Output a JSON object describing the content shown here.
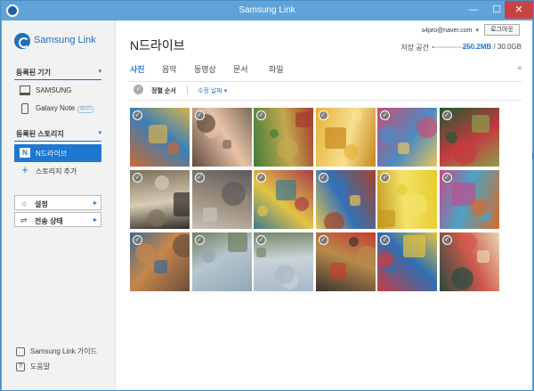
{
  "window": {
    "title": "Samsung Link",
    "min_glyph": "—",
    "max_glyph": "☐",
    "close_glyph": "✕"
  },
  "sidebar": {
    "logo_text": "Samsung Link",
    "devices_header": "등록된 기기",
    "devices": [
      {
        "label": "SAMSUNG",
        "icon": "laptop-icon"
      },
      {
        "label": "Galaxy Note",
        "icon": "phone-icon",
        "badge": "Wi-Fi"
      }
    ],
    "storages_header": "등록된 스토리지",
    "storages": [
      {
        "label": "N드라이브",
        "icon": "ndrive-icon",
        "badge_letter": "N",
        "active": true
      },
      {
        "label": "스토리지 추가",
        "icon": "plus-icon",
        "glyph": "+"
      }
    ],
    "settings_btn": {
      "label": "설정",
      "glyph": "☼",
      "arrow": "▸"
    },
    "transfer_btn": {
      "label": "전송 상태",
      "glyph": "⇌",
      "arrow": "▸"
    },
    "guide_label": "Samsung Link 가이드",
    "help_label": "도움말",
    "help_glyph": "?",
    "chevron": "▾"
  },
  "header": {
    "account": "s4pro@naver.com",
    "account_dropdown": "▾",
    "logout_label": "로그아웃",
    "page_title": "N드라이브",
    "storage_label": "저장 공간",
    "storage_used": "250.2MB",
    "storage_total": "/ 30.0GB",
    "storage_fraction": 0.01
  },
  "tabs": [
    {
      "label": "사진",
      "active": true
    },
    {
      "label": "음악",
      "active": false
    },
    {
      "label": "동영상",
      "active": false
    },
    {
      "label": "문서",
      "active": false
    },
    {
      "label": "파일",
      "active": false
    }
  ],
  "view_toggle": {
    "list_glyph": "≡",
    "grid_glyph": "▦"
  },
  "toolbar": {
    "sort_label": "정렬 순서",
    "sort_value": "수정 날짜",
    "sort_arrow": "▾",
    "check_glyph": "✓"
  },
  "photos": [
    {
      "name": "photo-storefront",
      "colors": [
        "#c86b32",
        "#3a7fb7",
        "#d9b24c"
      ]
    },
    {
      "name": "photo-selfie",
      "colors": [
        "#5e4a3c",
        "#e8c2a7",
        "#7a6a5a"
      ]
    },
    {
      "name": "photo-child-trees",
      "colors": [
        "#3f7d3a",
        "#c3a84e",
        "#a43c2e"
      ]
    },
    {
      "name": "photo-yellow-flower",
      "colors": [
        "#e7b23a",
        "#f6df90",
        "#c9861d"
      ]
    },
    {
      "name": "photo-colorful-dots",
      "colors": [
        "#c74f73",
        "#4d8ac2",
        "#e6c45b"
      ]
    },
    {
      "name": "photo-christmas-tree",
      "colors": [
        "#1f5a30",
        "#c43a3f",
        "#8aa04c"
      ]
    },
    {
      "name": "photo-girl-sitting",
      "colors": [
        "#7c6f5a",
        "#d8ccb5",
        "#2f2a26"
      ]
    },
    {
      "name": "photo-street",
      "colors": [
        "#5c5a5a",
        "#9d8f80",
        "#c9c0b6"
      ]
    },
    {
      "name": "photo-colorful-toys",
      "colors": [
        "#a83d4b",
        "#e3c346",
        "#3d7b8f"
      ]
    },
    {
      "name": "photo-bunny-sign",
      "colors": [
        "#a3432d",
        "#3471b5",
        "#e7c550"
      ]
    },
    {
      "name": "photo-lemons",
      "colors": [
        "#e6cc2c",
        "#f3e26a",
        "#c49a1f"
      ]
    },
    {
      "name": "photo-colorful-rings",
      "colors": [
        "#d66b2b",
        "#4aa3c4",
        "#c44a8b"
      ]
    },
    {
      "name": "photo-figurines",
      "colors": [
        "#6b4e3d",
        "#c6874a",
        "#3f6a92"
      ]
    },
    {
      "name": "photo-sky",
      "colors": [
        "#8ea8b8",
        "#b8c6cc",
        "#6f7f60"
      ]
    },
    {
      "name": "photo-field",
      "colors": [
        "#a9b9c8",
        "#c9d3d8",
        "#77876b"
      ]
    },
    {
      "name": "photo-bottles",
      "colors": [
        "#3b3430",
        "#b88a4a",
        "#c53d32"
      ]
    },
    {
      "name": "photo-candy",
      "colors": [
        "#c73d44",
        "#2e6fb2",
        "#e5c43c"
      ]
    },
    {
      "name": "photo-ice-cream-sign",
      "colors": [
        "#2b4a42",
        "#d05a4c",
        "#e7d7b3"
      ]
    }
  ]
}
